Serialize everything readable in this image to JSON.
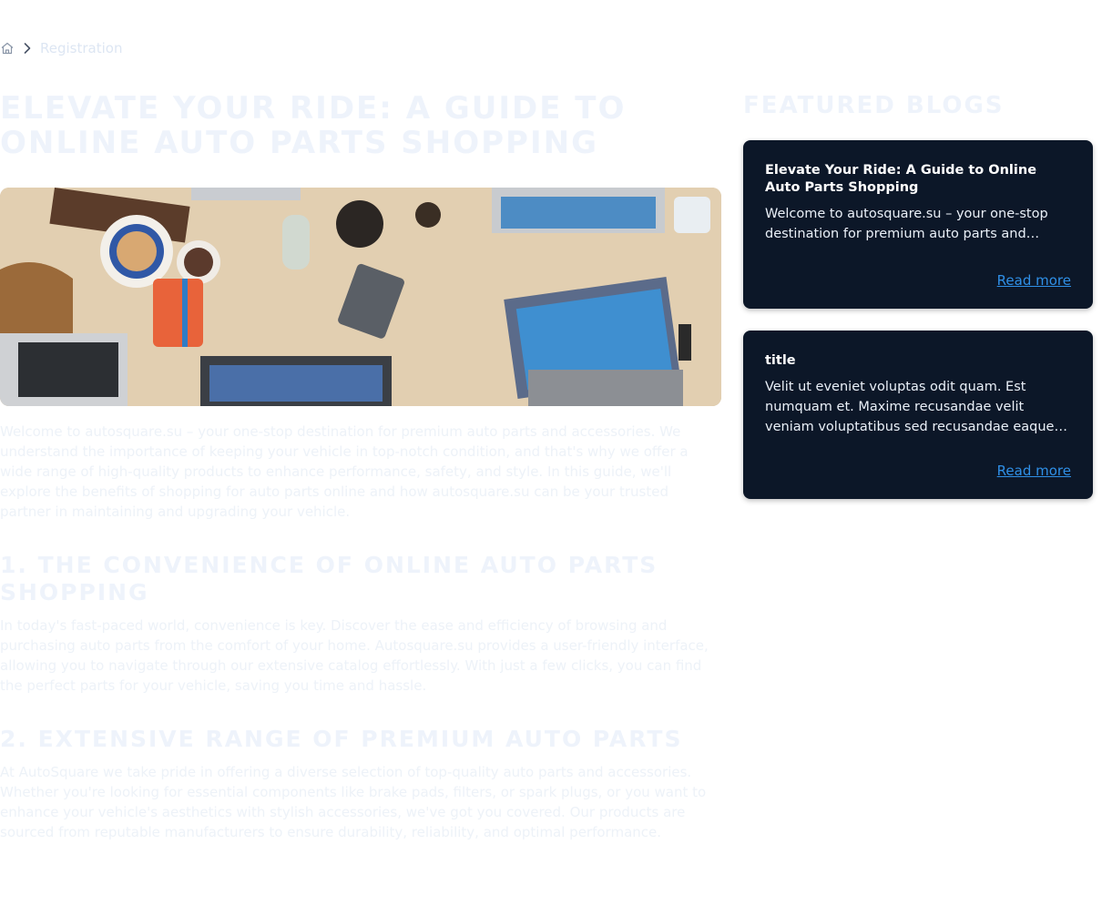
{
  "breadcrumb": {
    "home_icon": "home-icon",
    "separator_icon": "chevron-right-icon",
    "current": "Registration"
  },
  "article": {
    "title": "Elevate Your Ride: A Guide to Online Auto Parts Shopping",
    "intro": "Welcome to autosquare.su – your one-stop destination for premium auto parts and accessories. We understand the importance of keeping your vehicle in top-notch condition, and that's why we offer a wide range of high-quality products to enhance performance, safety, and style. In this guide, we'll explore the benefits of shopping for auto parts online and how autosquare.su can be your trusted partner in maintaining and upgrading your vehicle.",
    "sections": [
      {
        "heading": "1. The Convenience of Online Auto Parts Shopping",
        "text": "In today's fast-paced world, convenience is key. Discover the ease and efficiency of browsing and purchasing auto parts from the comfort of your home. Autosquare.su provides a user-friendly interface, allowing you to navigate through our extensive catalog effortlessly. With just a few clicks, you can find the perfect parts for your vehicle, saving you time and hassle."
      },
      {
        "heading": "2. Extensive Range of Premium Auto Parts",
        "text": "At AutoSquare we take pride in offering a diverse selection of top-quality auto parts and accessories. Whether you're looking for essential components like brake pads, filters, or spark plugs, or you want to enhance your vehicle's aesthetics with stylish accessories, we've got you covered. Our products are sourced from reputable manufacturers to ensure durability, reliability, and optimal performance."
      }
    ]
  },
  "featured": {
    "title": "Featured Blogs",
    "cards": [
      {
        "title": "Elevate Your Ride: A Guide to Online Auto Parts Shopping",
        "excerpt": "Welcome to autosquare.su – your one-stop destination for premium auto parts and accessories.",
        "read_more": "Read more"
      },
      {
        "title": "title",
        "excerpt": "Velit ut eveniet voluptas odit quam. Est numquam et. Maxime recusandae velit veniam voluptatibus sed recusandae eaque et harum.",
        "read_more": "Read more"
      }
    ]
  },
  "colors": {
    "card_background": "#0c1728",
    "link": "#2f8fe6",
    "faded_text": "#eef3fb"
  }
}
